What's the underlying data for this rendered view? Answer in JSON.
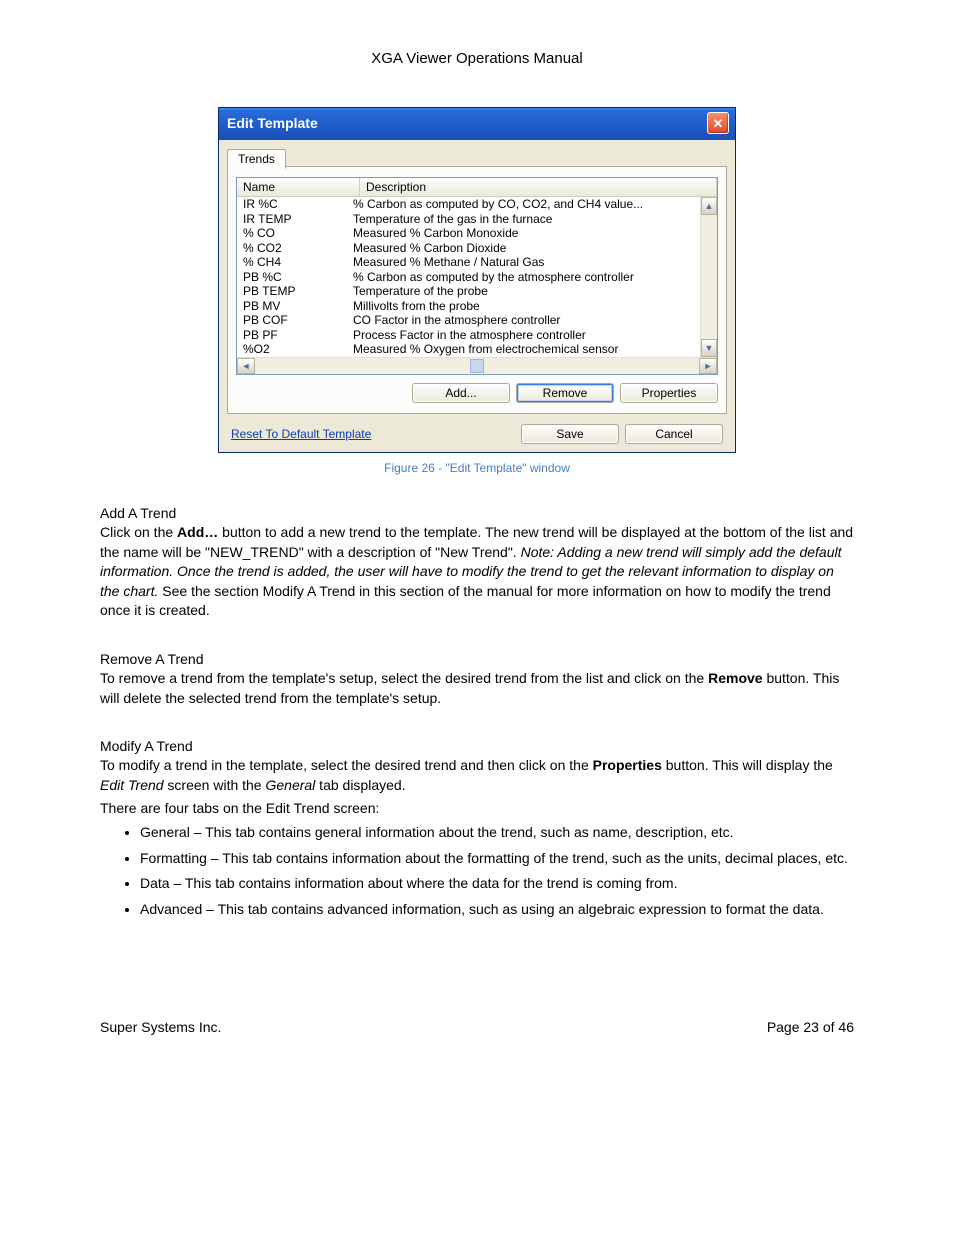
{
  "doc": {
    "title": "XGA Viewer Operations Manual",
    "footer_left": "Super Systems Inc.",
    "footer_right": "Page 23 of 46"
  },
  "figure_caption": "Figure 26 - \"Edit Template\" window",
  "window": {
    "title": "Edit Template",
    "tab_label": "Trends",
    "columns": {
      "name": "Name",
      "desc": "Description"
    },
    "rows": [
      {
        "name": "IR %C",
        "desc": "% Carbon as computed by CO, CO2, and CH4 value..."
      },
      {
        "name": "IR TEMP",
        "desc": "Temperature of the gas in the furnace"
      },
      {
        "name": "% CO",
        "desc": "Measured % Carbon Monoxide"
      },
      {
        "name": "% CO2",
        "desc": "Measured % Carbon Dioxide"
      },
      {
        "name": "% CH4",
        "desc": "Measured % Methane / Natural Gas"
      },
      {
        "name": "PB %C",
        "desc": "% Carbon as computed by the atmosphere controller"
      },
      {
        "name": "PB TEMP",
        "desc": "Temperature of the probe"
      },
      {
        "name": "PB MV",
        "desc": "Millivolts from the probe"
      },
      {
        "name": "PB COF",
        "desc": "CO Factor in the atmosphere controller"
      },
      {
        "name": "PB PF",
        "desc": "Process Factor in the atmosphere controller"
      },
      {
        "name": "%O2",
        "desc": "Measured % Oxygen from electrochemical sensor"
      }
    ],
    "buttons": {
      "add": "Add...",
      "remove": "Remove",
      "properties": "Properties",
      "save": "Save",
      "cancel": "Cancel"
    },
    "reset_link": "Reset To Default Template"
  },
  "sections": {
    "add_title": "Add A Trend",
    "add_p1_a": "Click on the ",
    "add_p1_bold": "Add…",
    "add_p1_b": " button to add a new trend to the template.  The new trend will be displayed at the bottom of the list and the name will be \"NEW_TREND\" with a description of \"New Trend\".  ",
    "add_note_italic": "Note:  Adding a new trend will simply add the default information.  Once the trend is added, the user will have to modify the trend to get the relevant information to display on the chart.",
    "add_p1_c": "  See the section Modify A Trend in this section of the manual for more information on how to modify the trend once it is created.",
    "remove_title": "Remove A Trend",
    "remove_p_a": "To remove a trend from the template's setup, select the desired trend from the list and click on the ",
    "remove_p_bold": "Remove",
    "remove_p_b": " button.  This will delete the selected trend from the template's setup.",
    "modify_title": "Modify A Trend",
    "modify_p1_a": "To modify a trend in the template, select the desired trend and then click on the ",
    "modify_p1_bold": "Properties",
    "modify_p1_b": " button.  This will display the ",
    "modify_p1_it1": "Edit Trend",
    "modify_p1_c": " screen with the ",
    "modify_p1_it2": "General",
    "modify_p1_d": " tab displayed.",
    "modify_p2": "There are four tabs on the Edit Trend screen:",
    "bullets": [
      "General – This tab contains general information about the trend, such as name, description, etc.",
      "Formatting – This tab contains information about the formatting of the trend, such as the units, decimal places, etc.",
      "Data – This tab contains information about where the data for the trend is coming from.",
      "Advanced – This tab contains advanced information, such as using an algebraic expression to format the data."
    ]
  }
}
